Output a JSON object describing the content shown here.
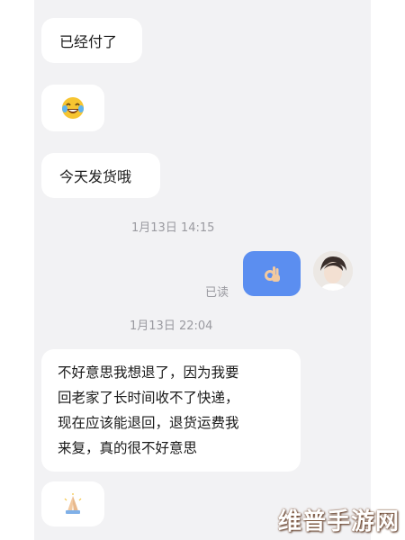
{
  "messages": {
    "paid": "已经付了",
    "ship_today": "今天发货哦",
    "long_lines": [
      "不好意思我想退了，因为我要",
      "回老家了长时间收不了快递，",
      "现在应该能退回，退货运费我",
      "来复，真的很不好意思"
    ]
  },
  "timestamps": {
    "first": "1月13日 14:15",
    "second": "1月13日 22:04"
  },
  "status": {
    "read": "已读"
  },
  "icons": {
    "laugh": "laughing-crying-emoji-icon",
    "ok_hand": "ok-hand-emoji-icon",
    "pray": "folded-hands-emoji-icon"
  },
  "colors": {
    "sent_bubble": "#5b8ef0",
    "chat_bg": "#f2f2f4"
  },
  "watermark": "维普手游网"
}
